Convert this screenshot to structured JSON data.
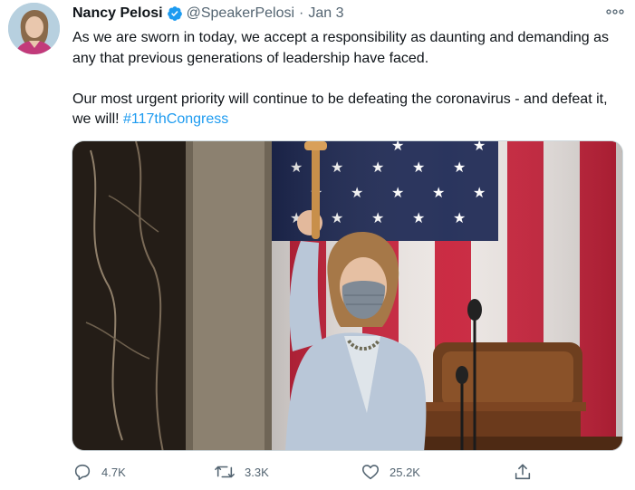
{
  "author": {
    "name": "Nancy Pelosi",
    "handle": "@SpeakerPelosi",
    "separator": "·",
    "date": "Jan 3",
    "verified": true,
    "verified_icon": "verified-badge-icon",
    "verified_color": "#1d9bf0"
  },
  "tweet": {
    "line1": "As we are sworn in today, we accept a responsibility as daunting and demanding as any that previous generations of leadership have faced.",
    "line2_text": "Our most urgent priority will continue to be defeating the coronavirus - and defeat it, we will! ",
    "hashtag": "#117thCongress"
  },
  "colors": {
    "text": "#0f1419",
    "secondary": "#536471",
    "link": "#1d9bf0"
  },
  "actions": {
    "reply": {
      "icon": "reply-icon",
      "count": "4.7K"
    },
    "retweet": {
      "icon": "retweet-icon",
      "count": "3.3K"
    },
    "like": {
      "icon": "heart-icon",
      "count": "25.2K"
    },
    "share": {
      "icon": "share-icon"
    }
  },
  "menu": {
    "icon": "more-options-icon"
  }
}
